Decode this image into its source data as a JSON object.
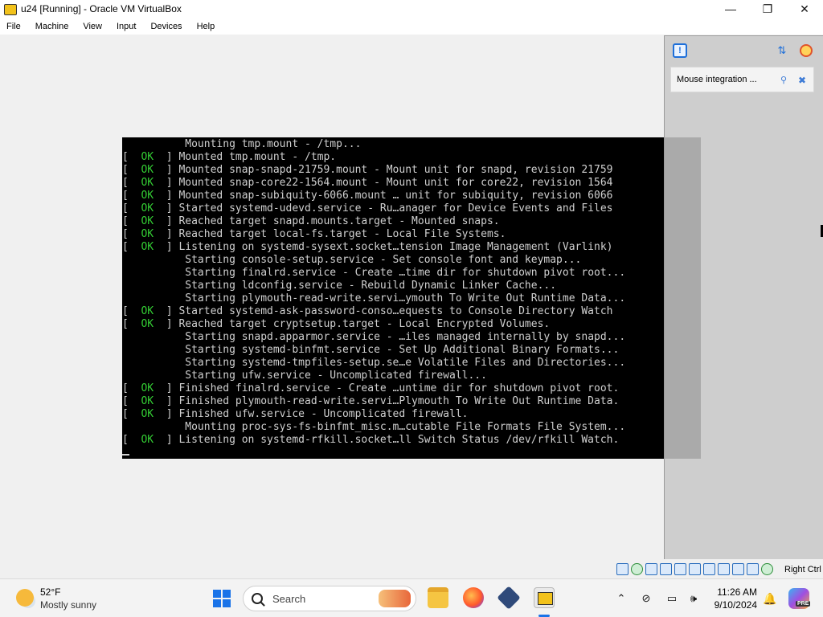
{
  "window": {
    "title": "u24 [Running] - Oracle VM VirtualBox",
    "minimize": "—",
    "maximize": "❐",
    "close": "✕"
  },
  "menu": [
    "File",
    "Machine",
    "View",
    "Input",
    "Devices",
    "Help"
  ],
  "console": {
    "lines": [
      {
        "status": "",
        "text": "Mounting tmp.mount - /tmp..."
      },
      {
        "status": "OK",
        "text": "Mounted tmp.mount - /tmp."
      },
      {
        "status": "OK",
        "text": "Mounted snap-snapd-21759.mount - Mount unit for snapd, revision 21759"
      },
      {
        "status": "OK",
        "text": "Mounted snap-core22-1564.mount - Mount unit for core22, revision 1564"
      },
      {
        "status": "OK",
        "text": "Mounted snap-subiquity-6066.mount … unit for subiquity, revision 6066"
      },
      {
        "status": "OK",
        "text": "Started systemd-udevd.service - Ru…anager for Device Events and Files"
      },
      {
        "status": "OK",
        "text": "Reached target snapd.mounts.target - Mounted snaps."
      },
      {
        "status": "OK",
        "text": "Reached target local-fs.target - Local File Systems."
      },
      {
        "status": "OK",
        "text": "Listening on systemd-sysext.socket…tension Image Management (Varlink)"
      },
      {
        "status": "",
        "text": "Starting console-setup.service - Set console font and keymap..."
      },
      {
        "status": "",
        "text": "Starting finalrd.service - Create …time dir for shutdown pivot root..."
      },
      {
        "status": "",
        "text": "Starting ldconfig.service - Rebuild Dynamic Linker Cache..."
      },
      {
        "status": "",
        "text": "Starting plymouth-read-write.servi…ymouth To Write Out Runtime Data..."
      },
      {
        "status": "OK",
        "text": "Started systemd-ask-password-conso…equests to Console Directory Watch"
      },
      {
        "status": "OK",
        "text": "Reached target cryptsetup.target - Local Encrypted Volumes."
      },
      {
        "status": "",
        "text": "Starting snapd.apparmor.service - …iles managed internally by snapd..."
      },
      {
        "status": "",
        "text": "Starting systemd-binfmt.service - Set Up Additional Binary Formats..."
      },
      {
        "status": "",
        "text": "Starting systemd-tmpfiles-setup.se…e Volatile Files and Directories..."
      },
      {
        "status": "",
        "text": "Starting ufw.service - Uncomplicated firewall..."
      },
      {
        "status": "OK",
        "text": "Finished finalrd.service - Create …untime dir for shutdown pivot root."
      },
      {
        "status": "OK",
        "text": "Finished plymouth-read-write.servi…Plymouth To Write Out Runtime Data."
      },
      {
        "status": "OK",
        "text": "Finished ufw.service - Uncomplicated firewall."
      },
      {
        "status": "",
        "text": "Mounting proc-sys-fs-binfmt_misc.m…cutable File Formats File System..."
      },
      {
        "status": "OK",
        "text": "Listening on systemd-rfkill.socket…ll Switch Status /dev/rfkill Watch."
      }
    ]
  },
  "notification": {
    "text": "Mouse integration ...",
    "icon_left": "pin-icon",
    "icon_right": "close-icon"
  },
  "statusbar": {
    "host_key": "Right Ctrl"
  },
  "taskbar": {
    "weather_temp": "52°F",
    "weather_desc": "Mostly sunny",
    "search_placeholder": "Search",
    "time": "11:26 AM",
    "date": "9/10/2024",
    "copilot_badge": "PRE"
  },
  "colors": {
    "ok_green": "#33cc33",
    "console_bg": "#000000",
    "accent_blue": "#1a73e8"
  }
}
